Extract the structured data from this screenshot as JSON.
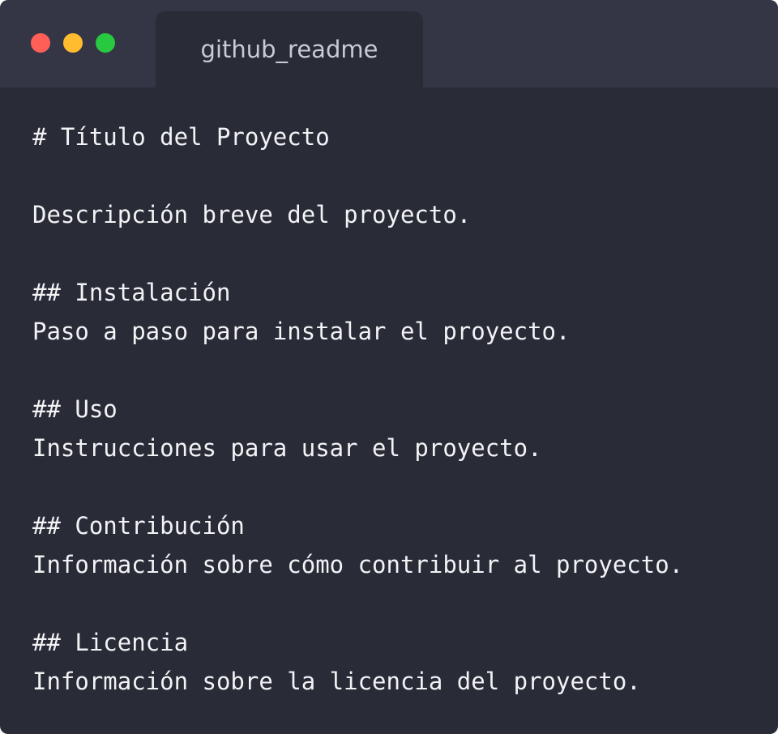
{
  "window": {
    "tab_title": "github_readme",
    "controls": {
      "close_color": "#ff5f57",
      "minimize_color": "#febc2e",
      "zoom_color": "#28c840"
    }
  },
  "editor": {
    "lines": [
      "# Título del Proyecto",
      "",
      "Descripción breve del proyecto.",
      "",
      "## Instalación",
      "Paso a paso para instalar el proyecto.",
      "",
      "## Uso",
      "Instrucciones para usar el proyecto.",
      "",
      "## Contribución",
      "Información sobre cómo contribuir al proyecto.",
      "",
      "## Licencia",
      "Información sobre la licencia del proyecto."
    ]
  }
}
